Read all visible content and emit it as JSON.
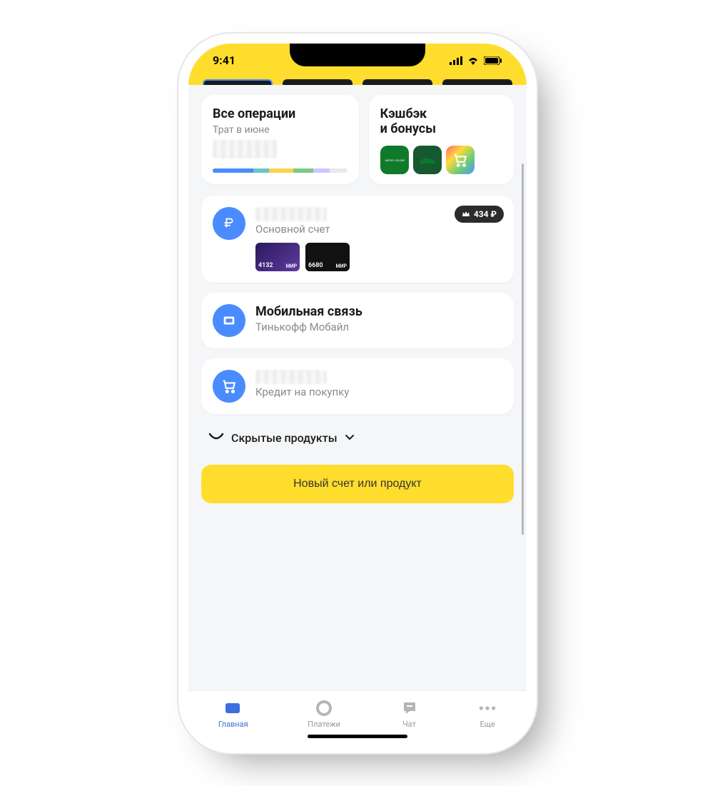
{
  "status": {
    "time": "9:41"
  },
  "summary": {
    "operations": {
      "title": "Все операции",
      "subtitle": "Трат в июне"
    },
    "cashback": {
      "line1": "Кэшбэк",
      "line2": "и бонусы"
    }
  },
  "spending_segments": [
    {
      "color": "#4a8bff",
      "pct": 30
    },
    {
      "color": "#6bc6c6",
      "pct": 12
    },
    {
      "color": "#ffd24a",
      "pct": 18
    },
    {
      "color": "#7fc97f",
      "pct": 15
    },
    {
      "color": "#c9c9ff",
      "pct": 12
    },
    {
      "color": "#e9e9e9",
      "pct": 13
    }
  ],
  "accounts": [
    {
      "icon": "ruble",
      "subtitle": "Основной счет",
      "badge": "434 ₽",
      "cards": [
        {
          "last4": "4132",
          "sys": "МИР",
          "style": "purple"
        },
        {
          "last4": "6680",
          "sys": "МИР",
          "style": "black"
        }
      ]
    },
    {
      "icon": "sim",
      "title": "Мобильная связь",
      "subtitle": "Тинькофф Мобайл"
    },
    {
      "icon": "cart",
      "subtitle": "Кредит на покупку"
    }
  ],
  "hidden_products": {
    "label": "Скрытые продукты"
  },
  "new_product_button": "Новый счет или продукт",
  "tabs": [
    {
      "key": "home",
      "label": "Главная",
      "active": true
    },
    {
      "key": "payments",
      "label": "Платежи",
      "active": false
    },
    {
      "key": "chat",
      "label": "Чат",
      "active": false
    },
    {
      "key": "more",
      "label": "Еще",
      "active": false
    }
  ]
}
